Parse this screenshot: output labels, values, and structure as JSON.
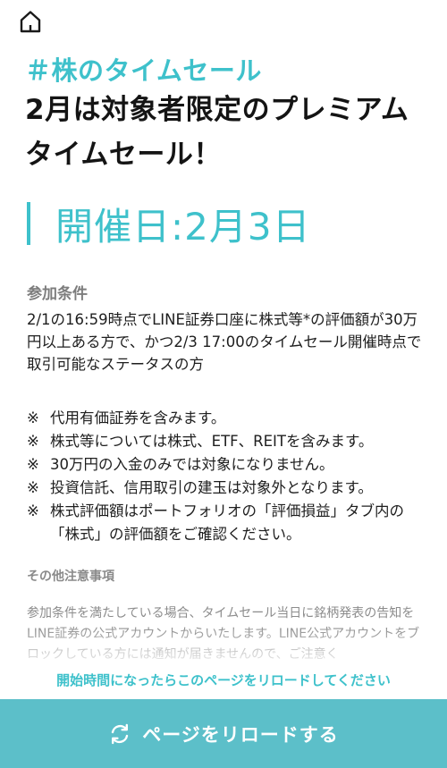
{
  "header": {
    "home_icon": "home-icon"
  },
  "hero": {
    "hashtag": "＃株のタイムセール",
    "headline": "2月は対象者限定のプレミアムタイムセール！",
    "date": "開催日:2月3日",
    "accent_color": "#3ec1cb"
  },
  "conditions": {
    "title": "参加条件",
    "body": "2/1の16:59時点でLINE証券口座に株式等*の評価額が30万円以上ある方で、かつ2/3 17:00のタイムセール開催時点で取引可能なステータスの方",
    "notes": [
      {
        "mark": "※",
        "text": "代用有価証券を含みます。"
      },
      {
        "mark": "※",
        "text": "株式等については株式、ETF、REITを含みます。"
      },
      {
        "mark": "※",
        "text": "30万円の入金のみでは対象になりません。"
      },
      {
        "mark": "※",
        "text": "投資信託、信用取引の建玉は対象外となります。"
      },
      {
        "mark": "※",
        "text": "株式評価額はポートフォリオの「評価損益」タブ内の「株式」の評価額をご確認ください。"
      }
    ]
  },
  "other": {
    "title": "その他注意事項",
    "body": "参加条件を満たしている場合、タイムセール当日に銘柄発表の告知をLINE証券の公式アカウントからいたします。LINE公式アカウントをブロックしている方には通知が届きませんので、ご注意く"
  },
  "footer": {
    "notice": "開始時間になったらこのページをリロードしてください",
    "reload_label": "ページをリロードする",
    "reload_icon": "reload-icon",
    "button_color": "#5cbfc9"
  }
}
